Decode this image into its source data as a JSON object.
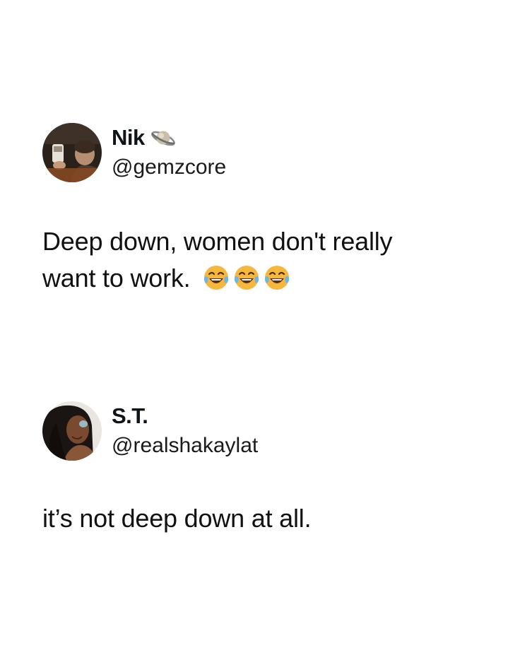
{
  "tweets": [
    {
      "display_name": "Nik",
      "handle": "@gemzcore",
      "badge_icon": "ringed-planet-icon",
      "text_line1": "Deep down, women don't really",
      "text_line2": "want to work.",
      "emojis": [
        "face-with-tears-of-joy-icon",
        "face-with-tears-of-joy-icon",
        "face-with-tears-of-joy-icon"
      ]
    },
    {
      "display_name": "S.T.",
      "handle": "@realshakaylat",
      "text": "it’s not deep down at all."
    }
  ],
  "colors": {
    "text": "#0f1419",
    "background": "#ffffff",
    "emoji_yellow": "#f6b73c"
  }
}
